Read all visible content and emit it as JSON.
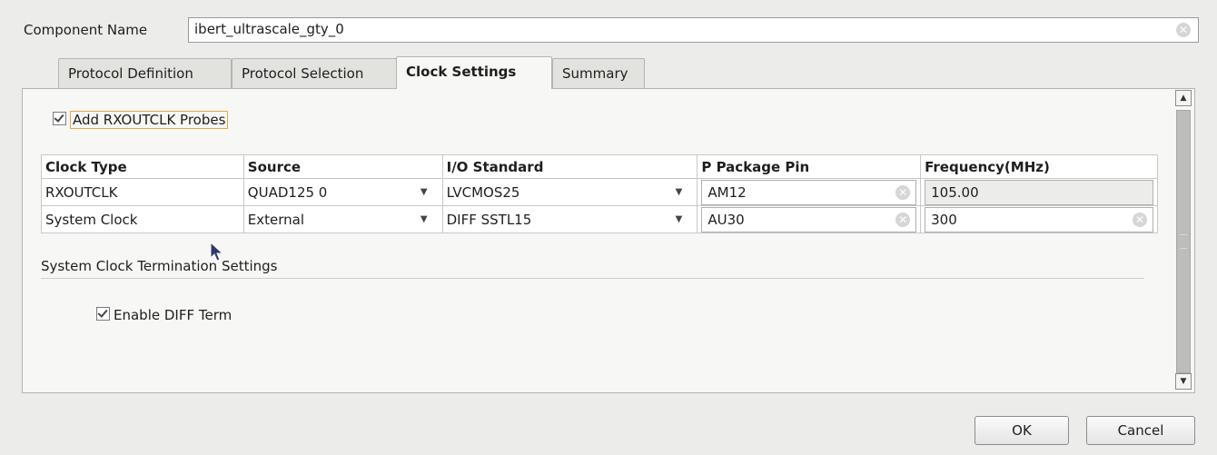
{
  "component": {
    "label": "Component Name",
    "value": "ibert_ultrascale_gty_0"
  },
  "tabs": [
    {
      "label": "Protocol Definition",
      "active": false
    },
    {
      "label": "Protocol Selection",
      "active": false
    },
    {
      "label": "Clock Settings",
      "active": true
    },
    {
      "label": "Summary",
      "active": false
    }
  ],
  "probes": {
    "label": "Add RXOUTCLK Probes",
    "checked": true
  },
  "table": {
    "headers": [
      "Clock Type",
      "Source",
      "I/O Standard",
      "P Package Pin",
      "Frequency(MHz)"
    ],
    "rows": [
      {
        "clock_type": "RXOUTCLK",
        "source": "QUAD125 0",
        "io_standard": "LVCMOS25",
        "pin": "AM12",
        "frequency": "105.00"
      },
      {
        "clock_type": "System Clock",
        "source": "External",
        "io_standard": "DIFF SSTL15",
        "pin": "AU30",
        "frequency": "300"
      }
    ]
  },
  "termination": {
    "title": "System Clock Termination Settings",
    "diff_label": "Enable DIFF Term",
    "diff_checked": true
  },
  "buttons": {
    "ok": "OK",
    "cancel": "Cancel"
  },
  "icons": {
    "clear": "clear-icon",
    "dropdown": "chevron-down-icon",
    "cursor": "mouse-pointer-icon"
  }
}
